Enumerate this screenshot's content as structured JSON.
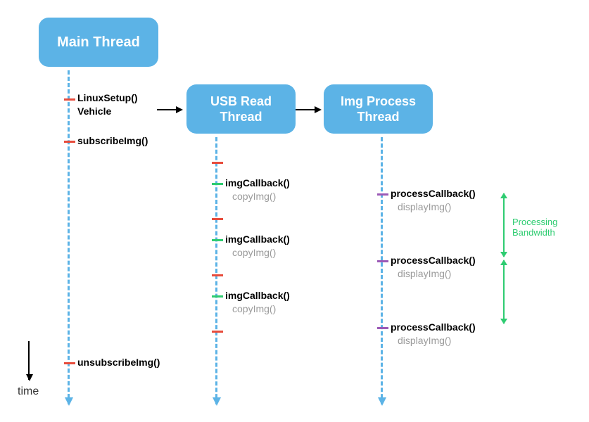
{
  "threads": {
    "main": {
      "title": "Main Thread"
    },
    "usb": {
      "title": "USB Read Thread"
    },
    "img": {
      "title": "Img Process Thread"
    }
  },
  "main_events": {
    "setup_line1": "LinuxSetup()",
    "setup_line2": "Vehicle",
    "subscribe": "subscribeImg()",
    "unsubscribe": "unsubscribeImg()"
  },
  "usb_events": {
    "callback": "imgCallback()",
    "copy": "copyImg()"
  },
  "img_events": {
    "callback": "processCallback()",
    "display": "displayImg()"
  },
  "bandwidth": {
    "line1": "Processing",
    "line2": "Bandwidth"
  },
  "axis": {
    "time": "time"
  }
}
